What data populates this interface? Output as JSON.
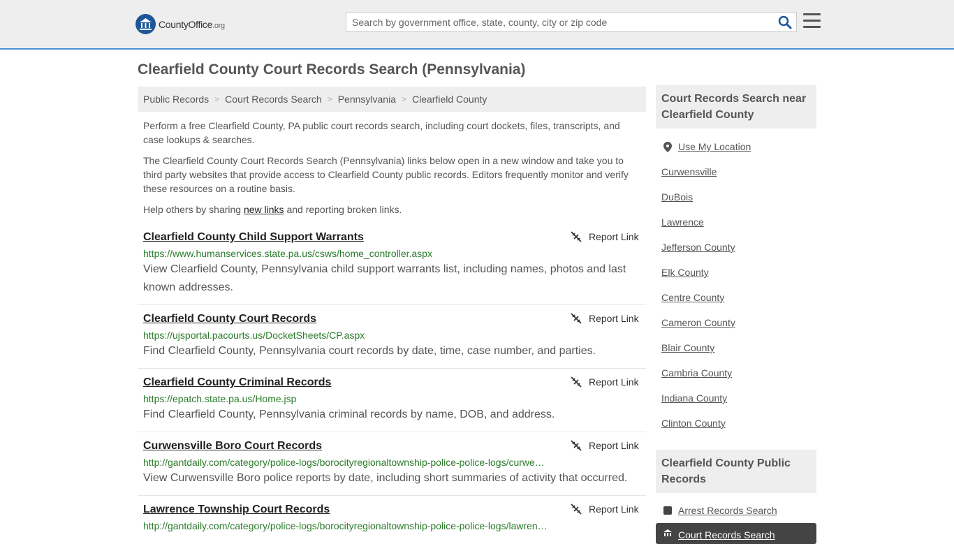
{
  "header": {
    "logo_main": "CountyOffice",
    "logo_tld": ".org",
    "search_placeholder": "Search by government office, state, county, city or zip code"
  },
  "page_title": "Clearfield County Court Records Search (Pennsylvania)",
  "breadcrumb": [
    "Public Records",
    "Court Records Search",
    "Pennsylvania",
    "Clearfield County"
  ],
  "intro": {
    "p1": "Perform a free Clearfield County, PA public court records search, including court dockets, files, transcripts, and case lookups & searches.",
    "p2": "The Clearfield County Court Records Search (Pennsylvania) links below open in a new window and take you to third party websites that provide access to Clearfield County public records. Editors frequently monitor and verify these resources on a routine basis.",
    "p3_before": "Help others by sharing ",
    "p3_link": "new links",
    "p3_after": " and reporting broken links."
  },
  "report_label": "Report Link",
  "results": [
    {
      "title": "Clearfield County Child Support Warrants",
      "url": "https://www.humanservices.state.pa.us/csws/home_controller.aspx",
      "desc": "View Clearfield County, Pennsylvania child support warrants list, including names, photos and last known addresses."
    },
    {
      "title": "Clearfield County Court Records",
      "url": "https://ujsportal.pacourts.us/DocketSheets/CP.aspx",
      "desc": "Find Clearfield County, Pennsylvania court records by date, time, case number, and parties."
    },
    {
      "title": "Clearfield County Criminal Records",
      "url": "https://epatch.state.pa.us/Home.jsp",
      "desc": "Find Clearfield County, Pennsylvania criminal records by name, DOB, and address."
    },
    {
      "title": "Curwensville Boro Court Records",
      "url": "http://gantdaily.com/category/police-logs/borocityregionaltownship-police-police-logs/curwe…",
      "desc": "View Curwensville Boro police reports by date, including short summaries of activity that occurred."
    },
    {
      "title": "Lawrence Township Court Records",
      "url": "http://gantdaily.com/category/police-logs/borocityregionaltownship-police-police-logs/lawren…",
      "desc": ""
    }
  ],
  "sidebar": {
    "near_heading": "Court Records Search near Clearfield County",
    "use_location": "Use My Location",
    "nearby": [
      "Curwensville",
      "DuBois",
      "Lawrence",
      "Jefferson County",
      "Elk County",
      "Centre County",
      "Cameron County",
      "Blair County",
      "Cambria County",
      "Indiana County",
      "Clinton County"
    ],
    "public_heading": "Clearfield County Public Records",
    "public_links": [
      "Arrest Records Search",
      "Court Records Search"
    ]
  },
  "colors": {
    "header_bg": "#eeeeee",
    "accent": "#4a90d9",
    "url_green": "#2a7b2a"
  }
}
